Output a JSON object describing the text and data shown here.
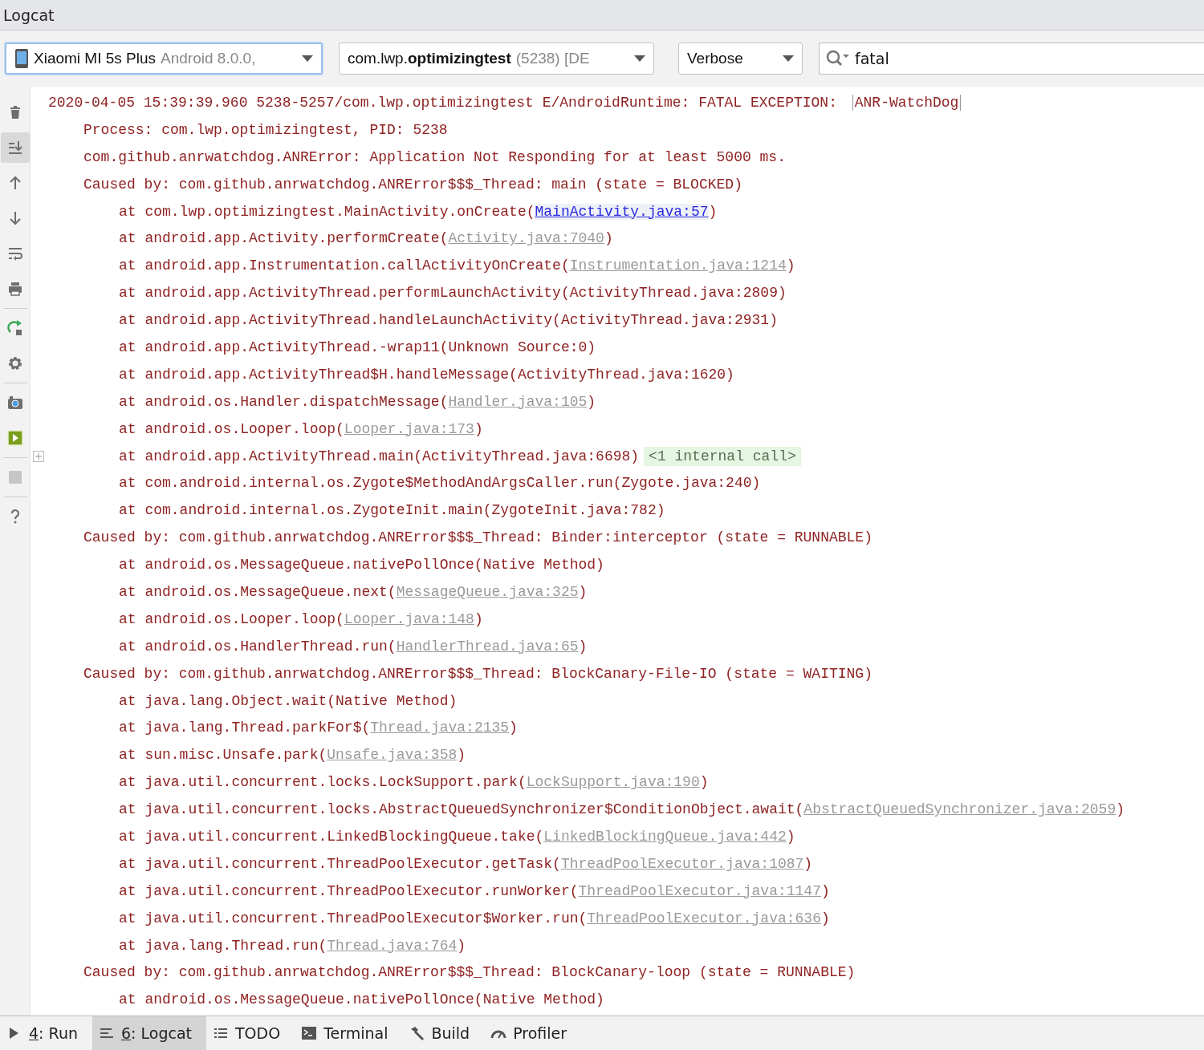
{
  "window": {
    "title": "Logcat"
  },
  "filters": {
    "device": {
      "name": "Xiaomi MI 5s Plus",
      "detail": "Android 8.0.0,",
      "focused": true
    },
    "process": {
      "name": "com.lwp.**optimizingtest**",
      "detail": "(5238) [DE"
    },
    "level": {
      "value": "Verbose"
    },
    "search": {
      "value": "fatal"
    }
  },
  "toolbar": [
    {
      "kind": "trash",
      "selected": false
    },
    {
      "kind": "scroll-end",
      "selected": true
    },
    {
      "kind": "up",
      "selected": false
    },
    {
      "kind": "down",
      "selected": false
    },
    {
      "kind": "wrap",
      "selected": false
    },
    {
      "kind": "print",
      "selected": false
    },
    {
      "kind": "restart",
      "selected": false
    },
    {
      "kind": "gear",
      "selected": false
    },
    {
      "kind": "camera",
      "selected": false
    },
    {
      "kind": "record",
      "selected": false
    },
    {
      "kind": "stop",
      "selected": false
    },
    {
      "kind": "help",
      "selected": false
    }
  ],
  "log": [
    {
      "kind": "header",
      "text": "2020-04-05 15:39:39.960 5238-5257/com.lwp.optimizingtest E/AndroidRuntime: FATAL EXCEPTION: ",
      "tag": "ANR-WatchDog"
    },
    {
      "kind": "message",
      "text": "Process: com.lwp.optimizingtest, PID: 5238"
    },
    {
      "kind": "message",
      "text": "com.github.anrwatchdog.ANRError: Application Not Responding for at least 5000 ms."
    },
    {
      "kind": "caused",
      "text": "Caused by: com.github.anrwatchdog.ANRError$$$_Thread: main (state = BLOCKED)"
    },
    {
      "kind": "frame",
      "text": "at com.lwp.optimizingtest.MainActivity.onCreate(",
      "link": "MainActivity.java:57",
      "link_primary": true,
      "tail": ")"
    },
    {
      "kind": "frame",
      "text": "at android.app.Activity.performCreate(",
      "link": "Activity.java:7040",
      "link_primary": false,
      "tail": ")"
    },
    {
      "kind": "frame",
      "text": "at android.app.Instrumentation.callActivityOnCreate(",
      "link": "Instrumentation.java:1214",
      "link_primary": false,
      "tail": ")"
    },
    {
      "kind": "frame",
      "text": "at android.app.ActivityThread.performLaunchActivity(ActivityThread.java:2809)"
    },
    {
      "kind": "frame",
      "text": "at android.app.ActivityThread.handleLaunchActivity(ActivityThread.java:2931)"
    },
    {
      "kind": "frame",
      "text": "at android.app.ActivityThread.-wrap11(Unknown Source:0)"
    },
    {
      "kind": "frame",
      "text": "at android.app.ActivityThread$H.handleMessage(ActivityThread.java:1620)"
    },
    {
      "kind": "frame",
      "text": "at android.os.Handler.dispatchMessage(",
      "link": "Handler.java:105",
      "link_primary": false,
      "tail": ")"
    },
    {
      "kind": "frame",
      "text": "at android.os.Looper.loop(",
      "link": "Looper.java:173",
      "link_primary": false,
      "tail": ")"
    },
    {
      "kind": "frame",
      "text": "at android.app.ActivityThread.main(ActivityThread.java:6698)",
      "note": "<1 internal call>",
      "fold": true
    },
    {
      "kind": "frame",
      "text": "at com.android.internal.os.Zygote$MethodAndArgsCaller.run(Zygote.java:240)"
    },
    {
      "kind": "frame",
      "text": "at com.android.internal.os.ZygoteInit.main(ZygoteInit.java:782)"
    },
    {
      "kind": "caused",
      "text": "Caused by: com.github.anrwatchdog.ANRError$$$_Thread: Binder:interceptor (state = RUNNABLE)"
    },
    {
      "kind": "frame",
      "text": "at android.os.MessageQueue.nativePollOnce(Native Method)"
    },
    {
      "kind": "frame",
      "text": "at android.os.MessageQueue.next(",
      "link": "MessageQueue.java:325",
      "link_primary": false,
      "tail": ")"
    },
    {
      "kind": "frame",
      "text": "at android.os.Looper.loop(",
      "link": "Looper.java:148",
      "link_primary": false,
      "tail": ")"
    },
    {
      "kind": "frame",
      "text": "at android.os.HandlerThread.run(",
      "link": "HandlerThread.java:65",
      "link_primary": false,
      "tail": ")"
    },
    {
      "kind": "caused",
      "text": "Caused by: com.github.anrwatchdog.ANRError$$$_Thread: BlockCanary-File-IO (state = WAITING)"
    },
    {
      "kind": "frame",
      "text": "at java.lang.Object.wait(Native Method)"
    },
    {
      "kind": "frame",
      "text": "at java.lang.Thread.parkFor$(",
      "link": "Thread.java:2135",
      "link_primary": false,
      "tail": ")"
    },
    {
      "kind": "frame",
      "text": "at sun.misc.Unsafe.park(",
      "link": "Unsafe.java:358",
      "link_primary": false,
      "tail": ")"
    },
    {
      "kind": "frame",
      "text": "at java.util.concurrent.locks.LockSupport.park(",
      "link": "LockSupport.java:190",
      "link_primary": false,
      "tail": ")"
    },
    {
      "kind": "frame",
      "text": "at java.util.concurrent.locks.AbstractQueuedSynchronizer$ConditionObject.await(",
      "link": "AbstractQueuedSynchronizer.java:2059",
      "link_primary": false,
      "tail": ")"
    },
    {
      "kind": "frame",
      "text": "at java.util.concurrent.LinkedBlockingQueue.take(",
      "link": "LinkedBlockingQueue.java:442",
      "link_primary": false,
      "tail": ")"
    },
    {
      "kind": "frame",
      "text": "at java.util.concurrent.ThreadPoolExecutor.getTask(",
      "link": "ThreadPoolExecutor.java:1087",
      "link_primary": false,
      "tail": ")"
    },
    {
      "kind": "frame",
      "text": "at java.util.concurrent.ThreadPoolExecutor.runWorker(",
      "link": "ThreadPoolExecutor.java:1147",
      "link_primary": false,
      "tail": ")"
    },
    {
      "kind": "frame",
      "text": "at java.util.concurrent.ThreadPoolExecutor$Worker.run(",
      "link": "ThreadPoolExecutor.java:636",
      "link_primary": false,
      "tail": ")"
    },
    {
      "kind": "frame",
      "text": "at java.lang.Thread.run(",
      "link": "Thread.java:764",
      "link_primary": false,
      "tail": ")"
    },
    {
      "kind": "caused",
      "text": "Caused by: com.github.anrwatchdog.ANRError$$$_Thread: BlockCanary-loop (state = RUNNABLE)"
    },
    {
      "kind": "frame",
      "text": "at android.os.MessageQueue.nativePollOnce(Native Method)"
    }
  ],
  "bottom_tabs": [
    {
      "kind": "run",
      "mnemonic": "4",
      "label": ": Run",
      "selected": false
    },
    {
      "kind": "logcat",
      "mnemonic": "6",
      "label": ": Logcat",
      "selected": true
    },
    {
      "kind": "todo",
      "label": "TODO",
      "selected": false
    },
    {
      "kind": "terminal",
      "label": "Terminal",
      "selected": false
    },
    {
      "kind": "build",
      "label": "Build",
      "selected": false
    },
    {
      "kind": "profiler",
      "label": "Profiler",
      "selected": false
    }
  ]
}
